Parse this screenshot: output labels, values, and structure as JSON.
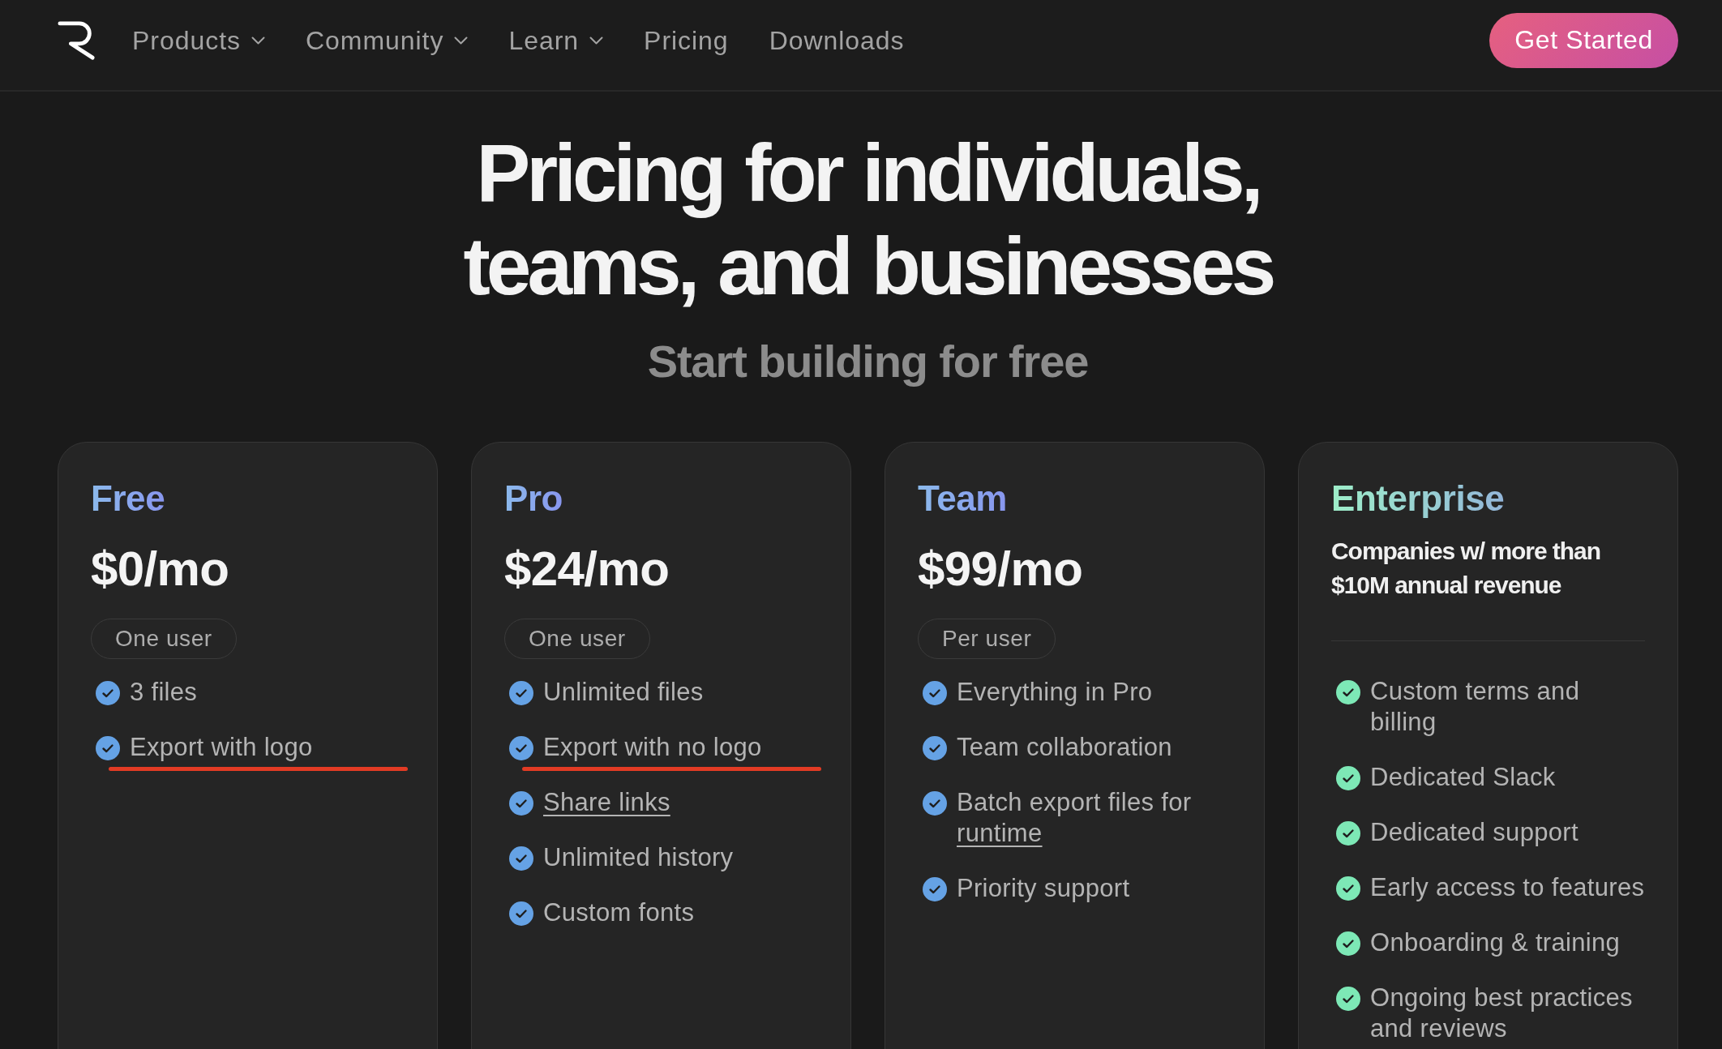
{
  "nav": {
    "items": [
      {
        "label": "Products",
        "kind": "menu"
      },
      {
        "label": "Community",
        "kind": "menu"
      },
      {
        "label": "Learn",
        "kind": "menu"
      },
      {
        "label": "Pricing",
        "kind": "link"
      },
      {
        "label": "Downloads",
        "kind": "link"
      }
    ],
    "cta": "Get Started"
  },
  "hero": {
    "title": "Pricing for individuals, teams, and businesses",
    "subtitle": "Start building for free"
  },
  "plans": [
    {
      "name": "Free",
      "color": "#65a2e5",
      "price": "$0/mo",
      "unit": "One user",
      "features": [
        {
          "text": "3 files",
          "highlighted": false
        },
        {
          "text": "Export with logo",
          "highlighted": true
        }
      ]
    },
    {
      "name": "Pro",
      "color": "#65a2e5",
      "price": "$24/mo",
      "unit": "One user",
      "features": [
        {
          "text": "Unlimited files",
          "highlighted": false
        },
        {
          "text": "Export with no logo",
          "highlighted": true
        },
        {
          "link": "Share links",
          "highlighted": false
        },
        {
          "text": "Unlimited history",
          "highlighted": false
        },
        {
          "text": "Custom fonts",
          "highlighted": false
        }
      ]
    },
    {
      "name": "Team",
      "color": "#65a2e5",
      "price": "$99/mo",
      "unit": "Per user",
      "features": [
        {
          "text": "Everything in Pro",
          "highlighted": false
        },
        {
          "text": "Team collaboration",
          "highlighted": false
        },
        {
          "text": "Batch export files for",
          "link": "runtime",
          "highlighted": false
        },
        {
          "text": "Priority support",
          "highlighted": false
        }
      ]
    },
    {
      "name": "Enterprise",
      "color": "#7de8b6",
      "description": "Companies w/ more than $10M annual revenue",
      "features": [
        {
          "text": "Custom terms and billing",
          "highlighted": false
        },
        {
          "text": "Dedicated Slack",
          "highlighted": false
        },
        {
          "text": "Dedicated support",
          "highlighted": false
        },
        {
          "text": "Early access to features",
          "highlighted": false
        },
        {
          "text": "Onboarding & training",
          "highlighted": false
        },
        {
          "text": "Ongoing best practices and reviews",
          "highlighted": false
        }
      ]
    }
  ]
}
